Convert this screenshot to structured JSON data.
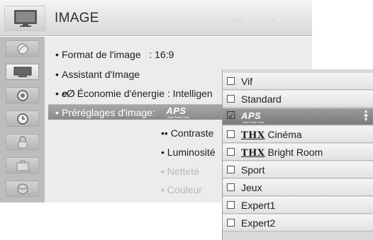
{
  "header": {
    "title": "IMAGE",
    "hint_move": "Dép.",
    "hint_ok": "OK",
    "hint_move_icon": "dpad-arrows-icon",
    "hint_ok_icon": "ok-circle-icon",
    "title_icon": "tv-picture-icon"
  },
  "sidebar": {
    "items": [
      {
        "icon": "satellite-dish-icon",
        "active": false
      },
      {
        "icon": "tv-picture-icon",
        "active": true
      },
      {
        "icon": "speaker-icon",
        "active": false
      },
      {
        "icon": "clock-icon",
        "active": false
      },
      {
        "icon": "lock-icon",
        "active": false
      },
      {
        "icon": "suitcase-icon",
        "active": false
      },
      {
        "icon": "globe-icon",
        "active": false
      }
    ]
  },
  "menu": {
    "format_label": "Format de l'image",
    "format_value": ": 16:9",
    "assistant_label": "Assistant d'Image",
    "energy_icon_text": "e",
    "energy_label": "Économie d'énergie :",
    "energy_value": "Intelligen",
    "presets_label": "Préréglages d'image:",
    "contrast_label": "•• Contraste",
    "brightness_label": "• Luminosité",
    "sharpness_label": "• Netteté",
    "color_label": "• Couleur"
  },
  "aps_logo": {
    "word": "APS",
    "sub": "Auto Power Save"
  },
  "dropdown": {
    "options": [
      {
        "label": "Vif",
        "checked": false,
        "selected": false
      },
      {
        "label": "Standard",
        "checked": false,
        "selected": false
      },
      {
        "label": "APS",
        "checked": true,
        "selected": true
      },
      {
        "label": "Cinéma",
        "prefix": "THX",
        "checked": false,
        "selected": false
      },
      {
        "label": "Bright Room",
        "prefix": "THX",
        "checked": false,
        "selected": false
      },
      {
        "label": "Sport",
        "checked": false,
        "selected": false
      },
      {
        "label": "Jeux",
        "checked": false,
        "selected": false
      },
      {
        "label": "Expert1",
        "checked": false,
        "selected": false
      },
      {
        "label": "Expert2",
        "checked": false,
        "selected": false
      }
    ],
    "check_glyph": "☑",
    "scroll_up": "▲",
    "scroll_down": "▼",
    "scroll_dot": "◉"
  },
  "colors": {
    "selected_row": "#8a8a8a",
    "sidebar_bg": "#bdbdbd",
    "content_bg": "#ececec"
  }
}
